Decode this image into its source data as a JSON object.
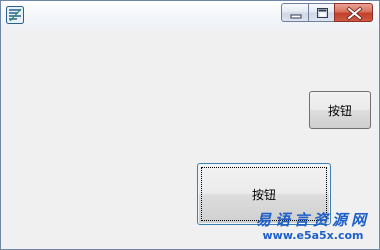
{
  "window": {
    "icon": "app-icon",
    "title": "",
    "caption_buttons": {
      "minimize_icon": "minimize-icon",
      "maximize_icon": "maximize-icon",
      "close_icon": "close-icon"
    }
  },
  "buttons": {
    "right_button_label": "按钮",
    "focused_button_label": "按钮"
  },
  "watermark": {
    "title": "易语言资源网",
    "url": "www.e5a5x.com"
  },
  "colors": {
    "client_background": "#f0f0f0",
    "close_button": "#c2402c",
    "watermark_text": "#1f5fc8",
    "focus_border": "#3c7fb1"
  }
}
